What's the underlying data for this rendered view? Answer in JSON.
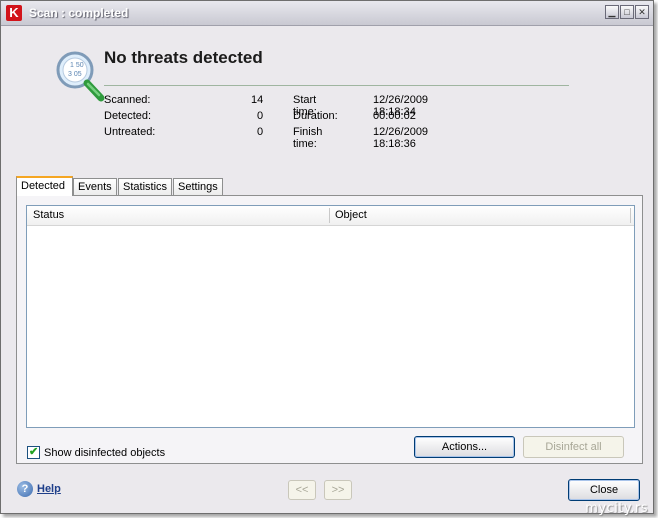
{
  "window": {
    "title": "Scan : completed",
    "logo_letter": "K"
  },
  "header": {
    "title": "No threats detected",
    "icon": "magnifier-check-icon"
  },
  "stats": {
    "scanned_label": "Scanned:",
    "scanned_value": "14",
    "detected_label": "Detected:",
    "detected_value": "0",
    "untreated_label": "Untreated:",
    "untreated_value": "0",
    "start_label": "Start time:",
    "start_value": "12/26/2009 18:18:34",
    "duration_label": "Duration:",
    "duration_value": "00:00:02",
    "finish_label": "Finish time:",
    "finish_value": "12/26/2009 18:18:36"
  },
  "tabs": [
    {
      "label": "Detected"
    },
    {
      "label": "Events"
    },
    {
      "label": "Statistics"
    },
    {
      "label": "Settings"
    }
  ],
  "table": {
    "columns": [
      "Status",
      "Object"
    ]
  },
  "options": {
    "show_disinfected_label": "Show disinfected objects",
    "show_disinfected_checked": true
  },
  "buttons": {
    "actions": "Actions...",
    "disinfect_all": "Disinfect all",
    "prev": "<<",
    "next": ">>",
    "close": "Close",
    "help": "Help"
  },
  "watermark": "mycity.rs",
  "colors": {
    "accent_tab": "#f5a623",
    "logo_red": "#d2131a",
    "link_blue": "#1f3f8a"
  }
}
